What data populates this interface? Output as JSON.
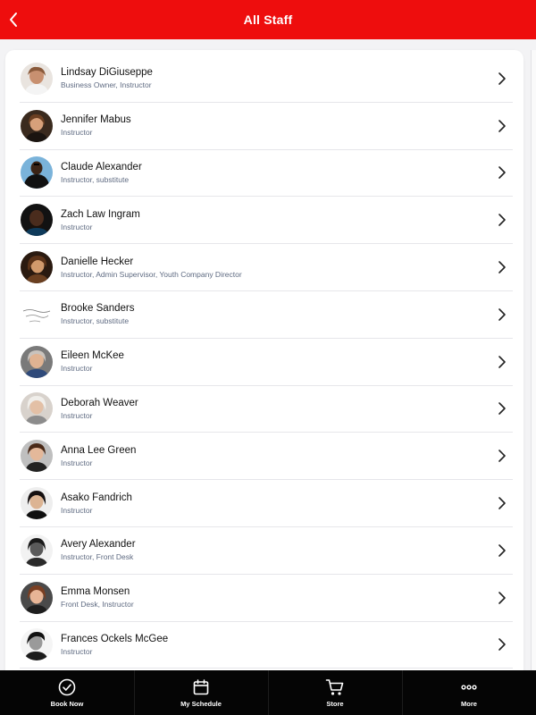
{
  "header": {
    "title": "All Staff",
    "background": "#ee0d0d"
  },
  "staff": [
    {
      "name": "Lindsay DiGiuseppe",
      "role": "Business Owner, Instructor"
    },
    {
      "name": "Jennifer Mabus",
      "role": "Instructor"
    },
    {
      "name": "Claude Alexander",
      "role": "Instructor, substitute"
    },
    {
      "name": "Zach Law Ingram",
      "role": "Instructor"
    },
    {
      "name": "Danielle Hecker",
      "role": "Instructor, Admin Supervisor, Youth Company Director"
    },
    {
      "name": "Brooke Sanders",
      "role": "Instructor, substitute"
    },
    {
      "name": "Eileen McKee",
      "role": "Instructor"
    },
    {
      "name": "Deborah Weaver",
      "role": "Instructor"
    },
    {
      "name": "Anna Lee Green",
      "role": "Instructor"
    },
    {
      "name": "Asako Fandrich",
      "role": "Instructor"
    },
    {
      "name": "Avery Alexander",
      "role": "Instructor, Front Desk"
    },
    {
      "name": "Emma Monsen",
      "role": "Front Desk, Instructor"
    },
    {
      "name": "Frances Ockels McGee",
      "role": "Instructor"
    }
  ],
  "tabs": [
    {
      "label": "Book Now",
      "icon": "check-circle-icon"
    },
    {
      "label": "My Schedule",
      "icon": "calendar-icon"
    },
    {
      "label": "Store",
      "icon": "cart-icon"
    },
    {
      "label": "More",
      "icon": "more-dots-icon"
    }
  ]
}
